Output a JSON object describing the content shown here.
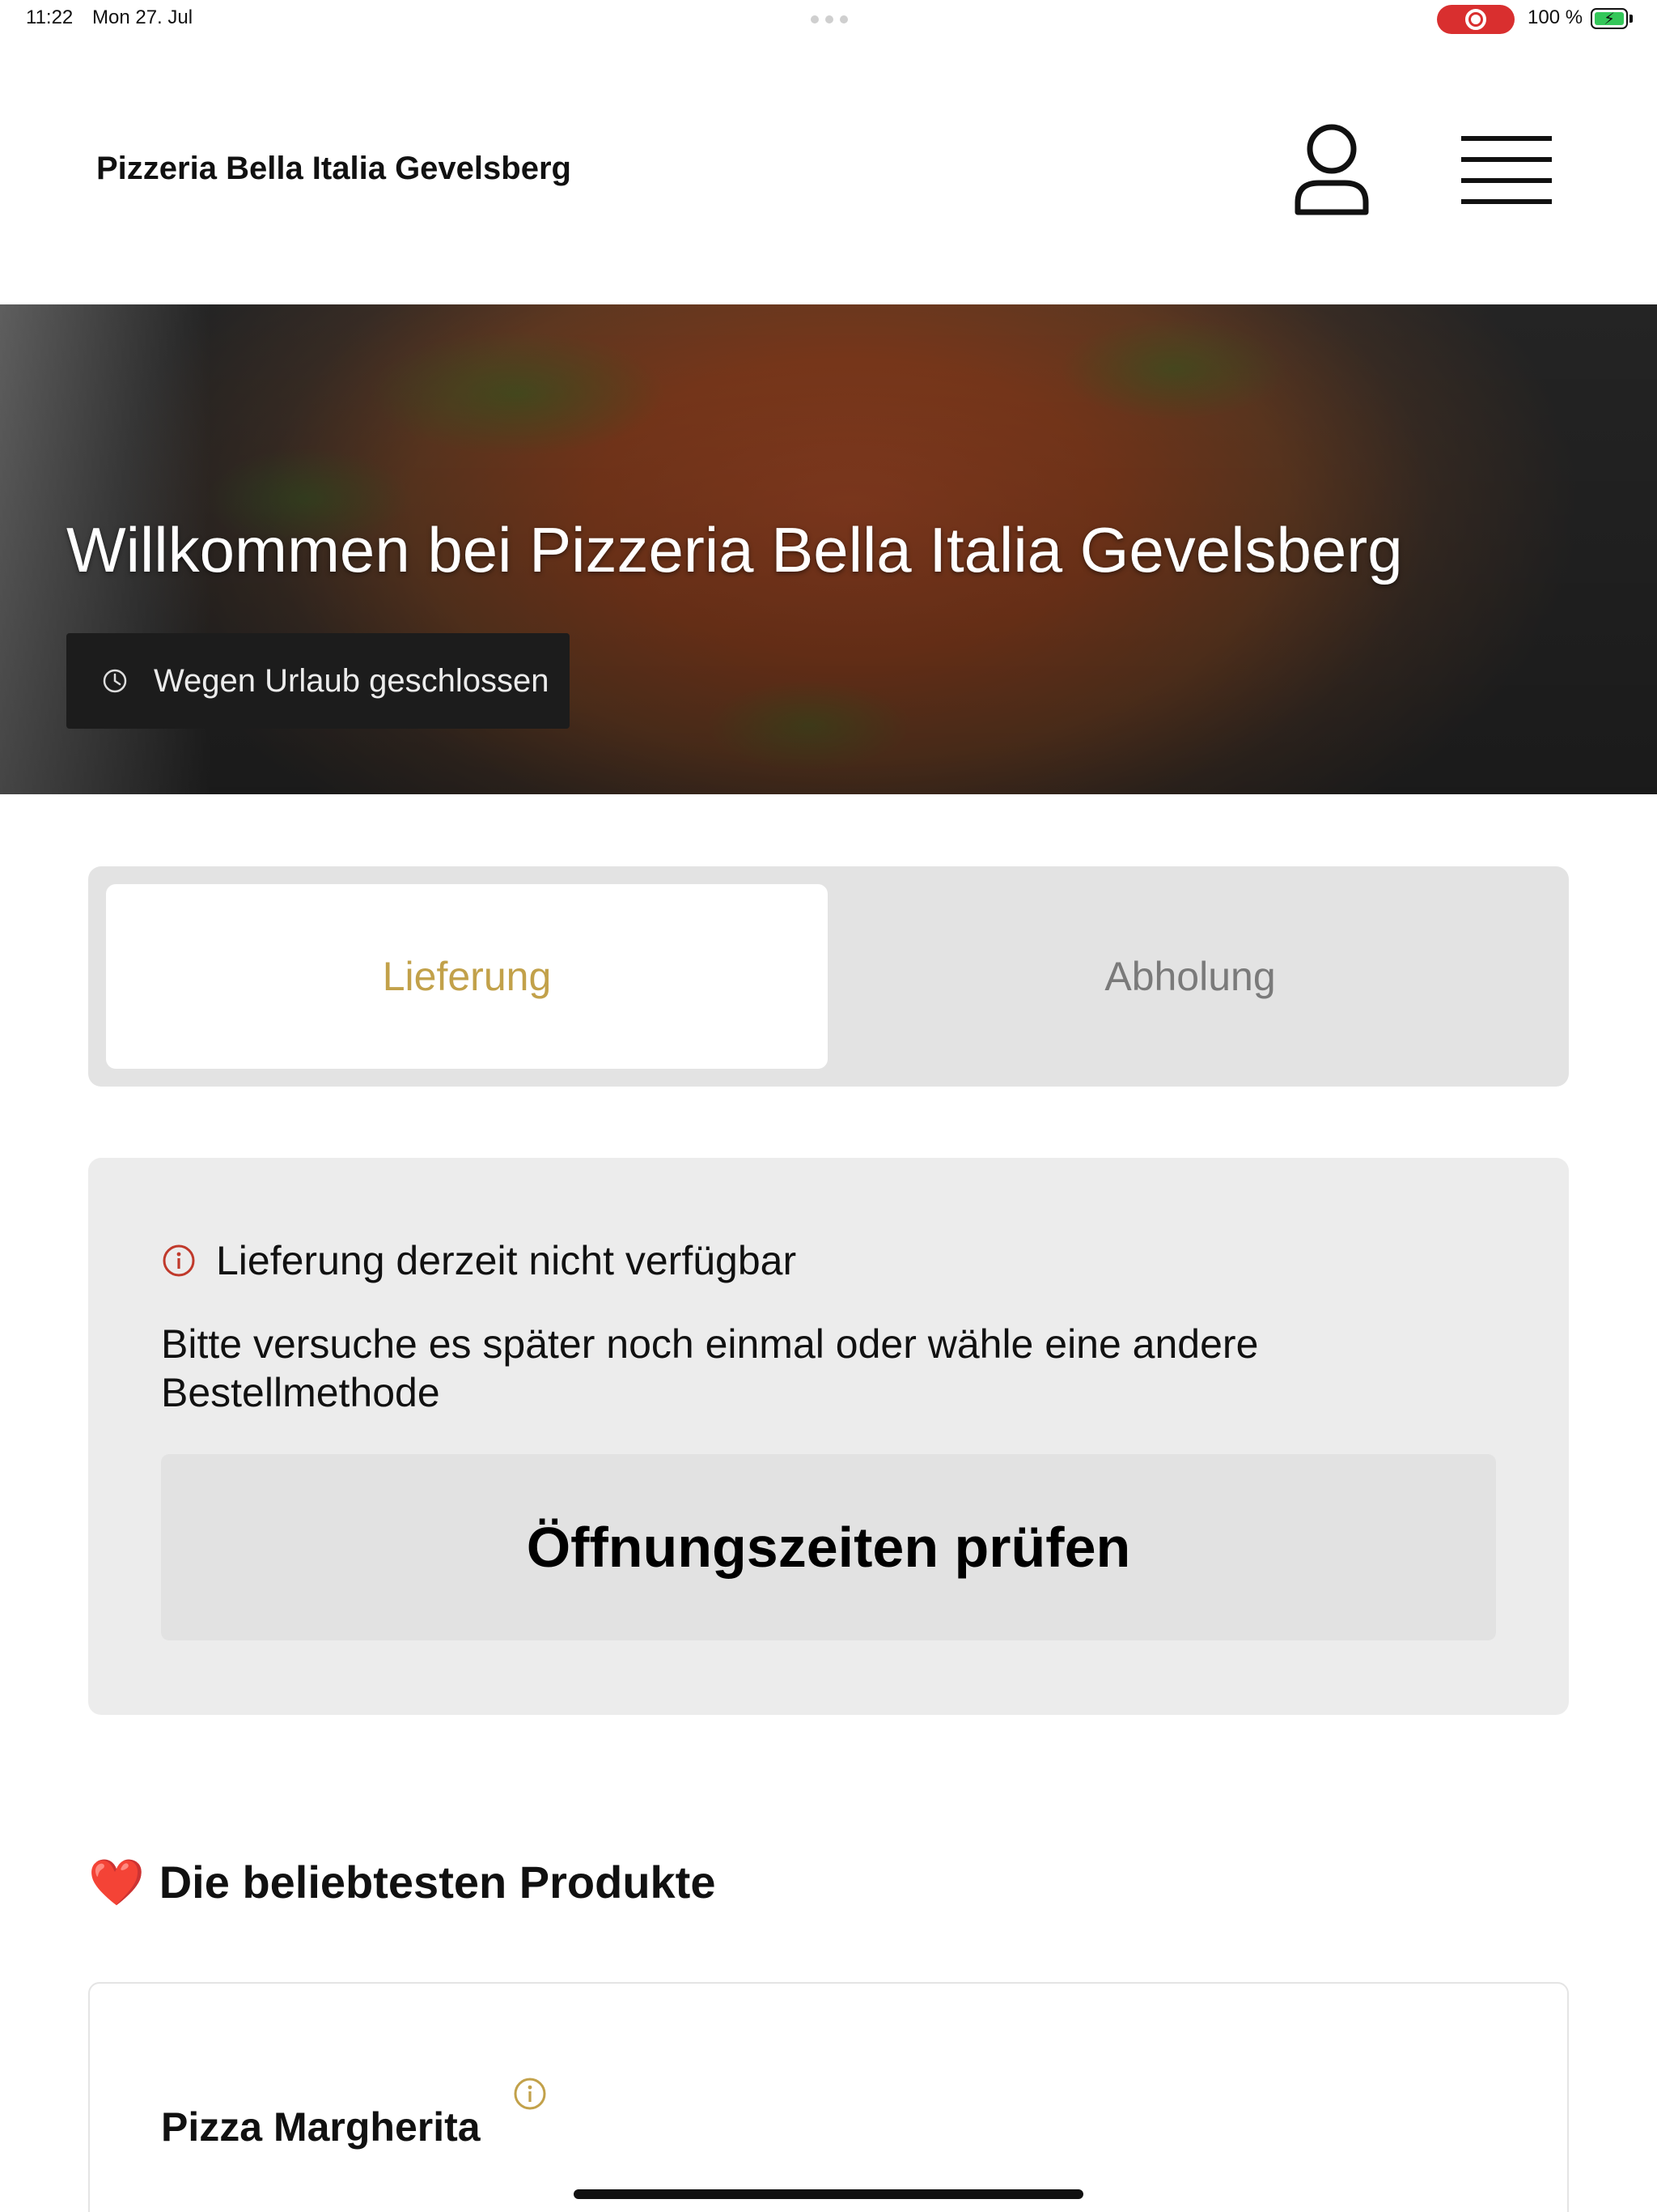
{
  "status_bar": {
    "time": "11:22",
    "date": "Mon 27. Jul",
    "battery_percent": "100 %",
    "battery_level": 1.0,
    "recording_color": "#d92f2f"
  },
  "header": {
    "brand": "Pizzeria Bella Italia Gevelsberg",
    "user_icon": "user-icon",
    "menu_icon": "hamburger-menu-icon"
  },
  "hero": {
    "title": "Willkommen bei Pizzeria Bella Italia Gevelsberg",
    "status_badge": "Wegen Urlaub geschlossen",
    "badge_icon": "clock-icon"
  },
  "order_tabs": {
    "delivery": "Lieferung",
    "pickup": "Abholung",
    "active": "delivery",
    "active_color": "#c2a14a"
  },
  "notice": {
    "title": "Lieferung derzeit nicht verfügbar",
    "message_line1": "Bitte versuche es später noch einmal oder wähle eine andere",
    "message_line2": "Bestellmethode",
    "button": "Öffnungszeiten prüfen",
    "icon": "info-icon",
    "icon_color": "#c0392b"
  },
  "popular": {
    "emoji": "❤️",
    "heading": "Die beliebtesten Produkte",
    "products": [
      {
        "name": "Pizza Margherita"
      }
    ]
  }
}
